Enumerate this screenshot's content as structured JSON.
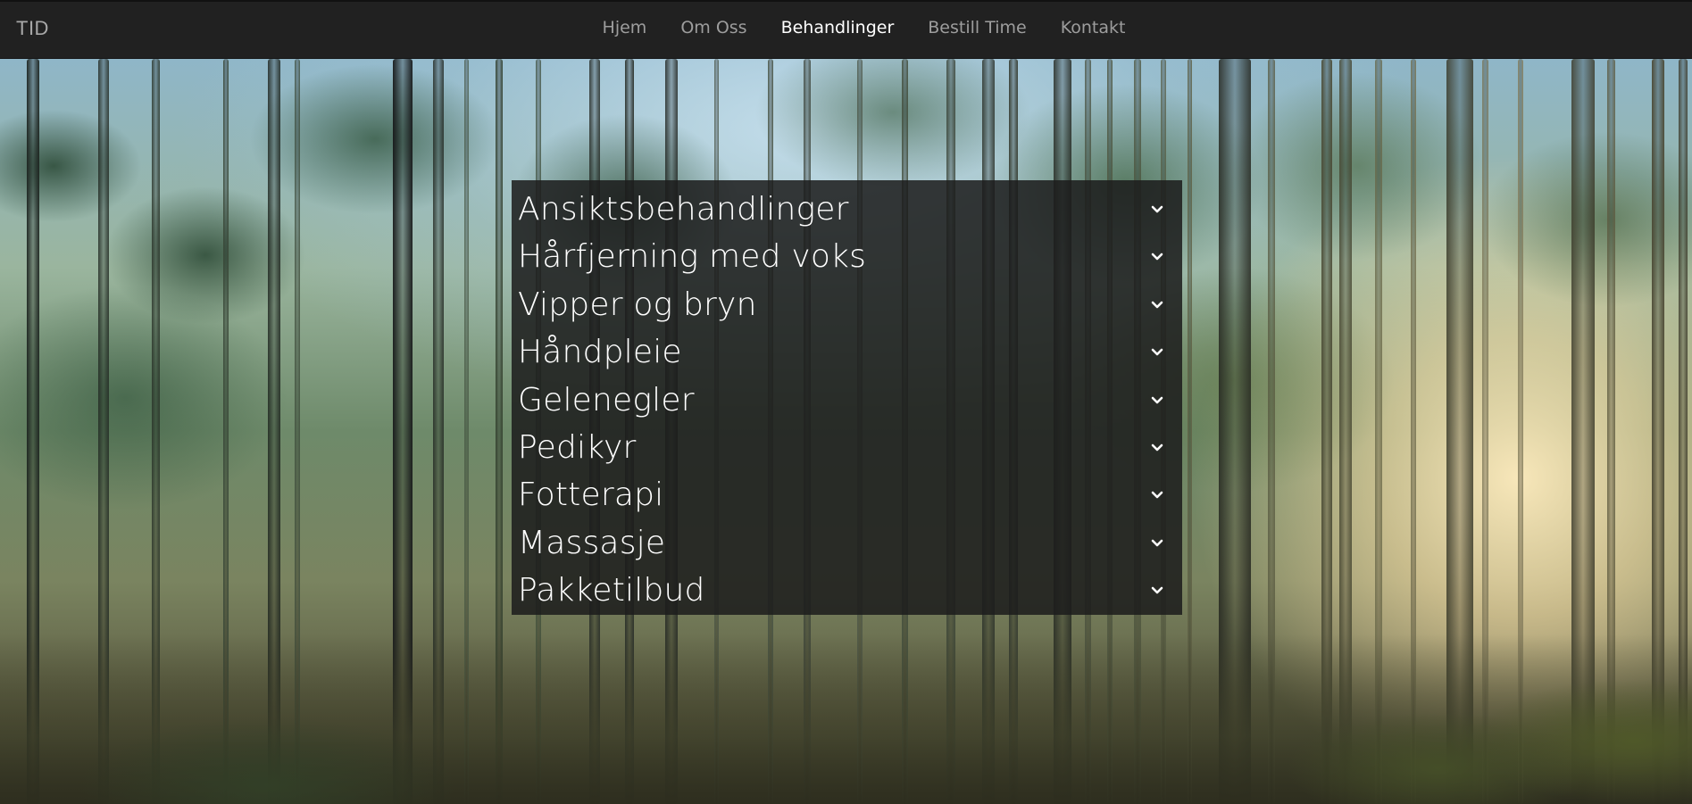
{
  "header": {
    "brand": "TID",
    "nav": [
      {
        "label": "Hjem",
        "active": false
      },
      {
        "label": "Om Oss",
        "active": false
      },
      {
        "label": "Behandlinger",
        "active": true
      },
      {
        "label": "Bestill Time",
        "active": false
      },
      {
        "label": "Kontakt",
        "active": false
      }
    ]
  },
  "accordion": {
    "items": [
      {
        "label": "Ansiktsbehandlinger",
        "icon": "chevron-down-icon"
      },
      {
        "label": "Hårfjerning med voks",
        "icon": "chevron-down-icon"
      },
      {
        "label": "Vipper og bryn",
        "icon": "chevron-down-icon"
      },
      {
        "label": "Håndpleie",
        "icon": "chevron-down-icon"
      },
      {
        "label": "Gelenegler",
        "icon": "chevron-down-icon"
      },
      {
        "label": "Pedikyr",
        "icon": "chevron-down-icon"
      },
      {
        "label": "Fotterapi",
        "icon": "chevron-down-icon"
      },
      {
        "label": "Massasje",
        "icon": "chevron-down-icon"
      },
      {
        "label": "Pakketilbud",
        "icon": "chevron-down-icon"
      }
    ]
  },
  "colors": {
    "navbar_bg": "#212121",
    "nav_link": "#9d9d9d",
    "nav_active": "#ffffff",
    "panel_bg": "#1c1c1c"
  }
}
